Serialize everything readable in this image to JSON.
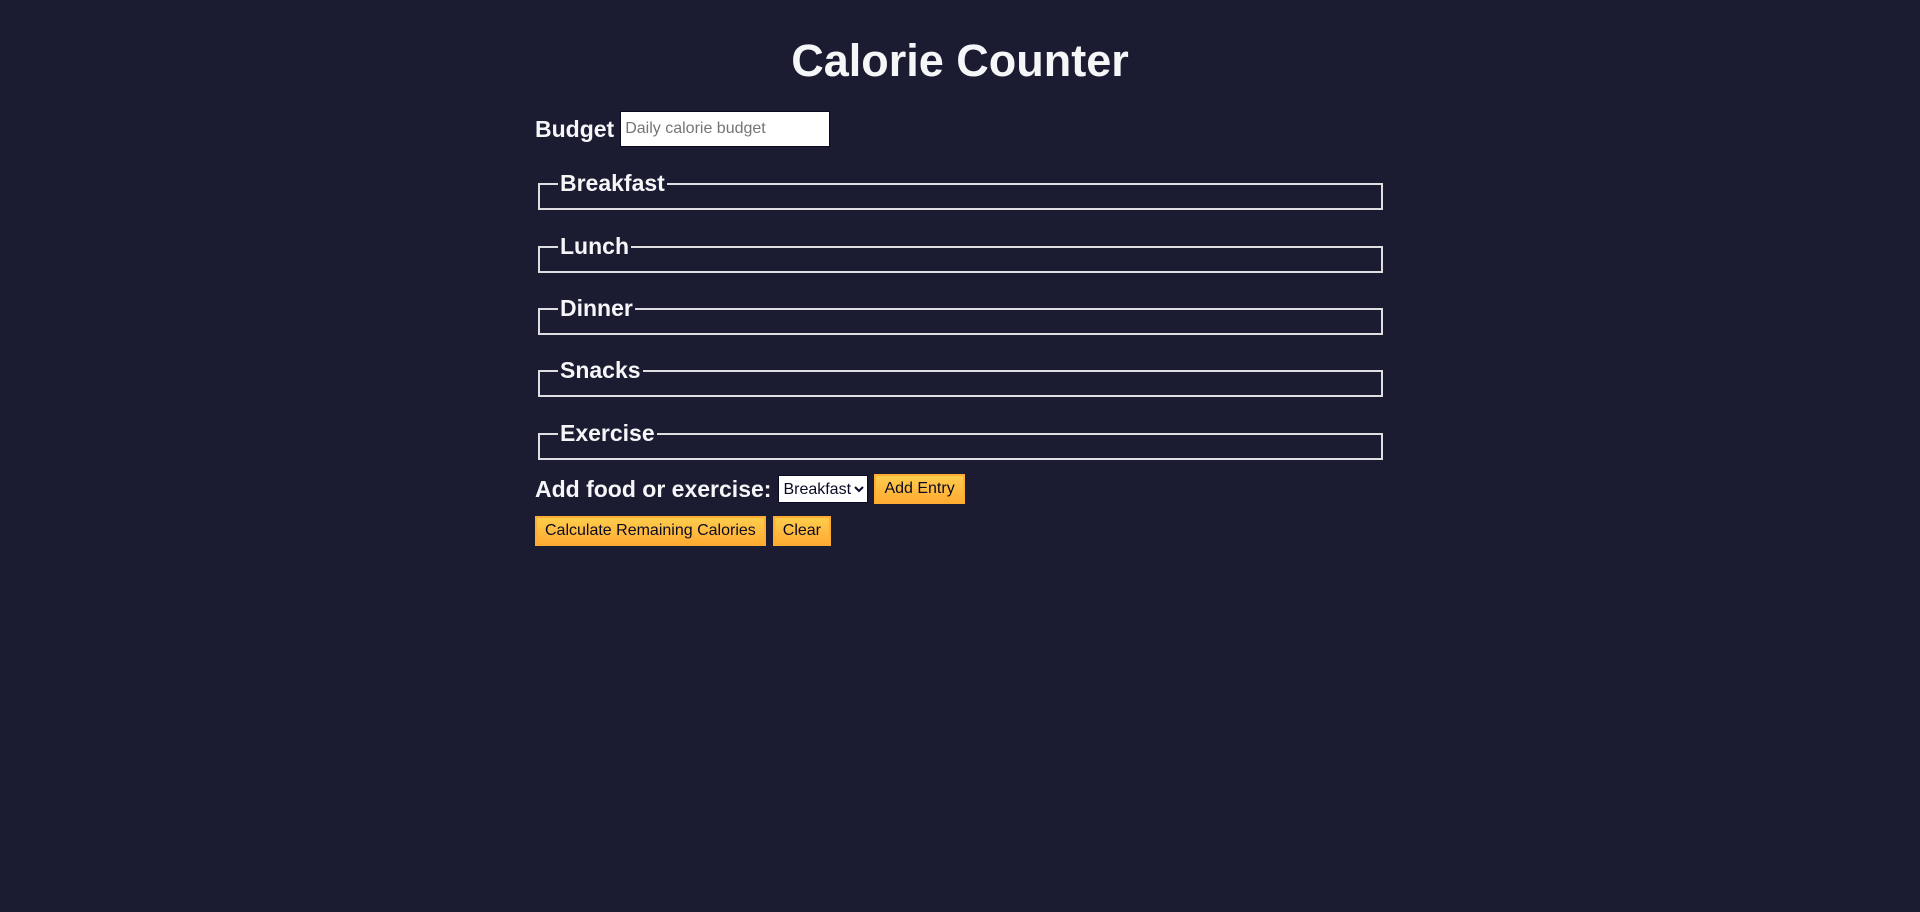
{
  "title": "Calorie Counter",
  "budget": {
    "label": "Budget",
    "placeholder": "Daily calorie budget",
    "value": ""
  },
  "fieldsets": [
    {
      "legend": "Breakfast"
    },
    {
      "legend": "Lunch"
    },
    {
      "legend": "Dinner"
    },
    {
      "legend": "Snacks"
    },
    {
      "legend": "Exercise"
    }
  ],
  "entry": {
    "label": "Add food or exercise:",
    "selected": "Breakfast",
    "add_button": "Add Entry"
  },
  "actions": {
    "calculate_button": "Calculate Remaining Calories",
    "clear_button": "Clear"
  },
  "colors": {
    "background": "#1b1b32",
    "text": "#f5f6f7",
    "button": "#feac32",
    "border": "#dfdfe2"
  }
}
